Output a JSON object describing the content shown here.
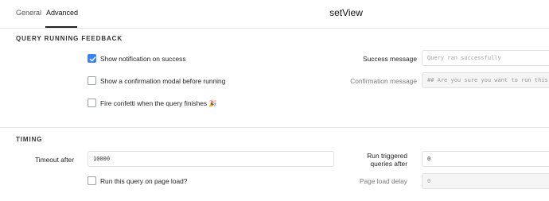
{
  "tabs": [
    {
      "label": "General",
      "active": false
    },
    {
      "label": "Advanced",
      "active": true
    }
  ],
  "header": {
    "title": "setView"
  },
  "feedback": {
    "section_title": "QUERY RUNNING FEEDBACK",
    "show_notification": {
      "label": "Show notification on success",
      "checked": true
    },
    "confirm_modal": {
      "label": "Show a confirmation modal before running",
      "checked": false
    },
    "confetti": {
      "label": "Fire confetti when the query finishes",
      "emoji": "🎉",
      "checked": false
    },
    "success_message": {
      "label": "Success message",
      "placeholder": "Query ran successfully"
    },
    "confirmation_message": {
      "label": "Confirmation message",
      "placeholder": "## Are you sure you want to run this"
    }
  },
  "timing": {
    "section_title": "TIMING",
    "timeout": {
      "label": "Timeout after",
      "value": "10000"
    },
    "run_on_load": {
      "label": "Run this query on page load?",
      "checked": false
    },
    "run_triggered": {
      "label_line1": "Run triggered",
      "label_line2": "queries after",
      "value": "0"
    },
    "page_load_delay": {
      "label": "Page load delay",
      "value": "0"
    }
  },
  "colors": {
    "accent": "#3b82f6"
  }
}
